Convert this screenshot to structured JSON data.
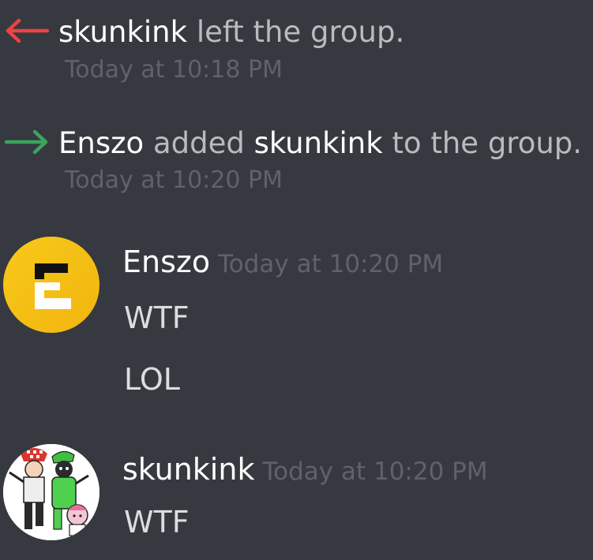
{
  "events": [
    {
      "user": "skunkink",
      "action": "left the group.",
      "timestamp": "Today at 10:18 PM",
      "arrow_color": "#ed4245"
    },
    {
      "actor": "Enszo",
      "action": "added",
      "target": "skunkink",
      "suffix": "to the group.",
      "timestamp": "Today at 10:20 PM",
      "arrow_color": "#3ba55c"
    }
  ],
  "messages": [
    {
      "author": "Enszo",
      "timestamp": "Today at 10:20 PM",
      "lines": [
        "WTF",
        "LOL"
      ],
      "avatar": "enszo-logo-avatar"
    },
    {
      "author": "skunkink",
      "timestamp": "Today at 10:20 PM",
      "lines": [
        "WTF"
      ],
      "avatar": "cartoon-group-avatar"
    }
  ],
  "colors": {
    "background": "#36393f",
    "username": "#ffffff",
    "message_text": "#dcddde",
    "timestamp": "#5f6268",
    "system_text": "#b9bbbe",
    "leave_arrow": "#ed4245",
    "join_arrow": "#3ba55c",
    "enszo_avatar_yellow": "#f5c518"
  }
}
